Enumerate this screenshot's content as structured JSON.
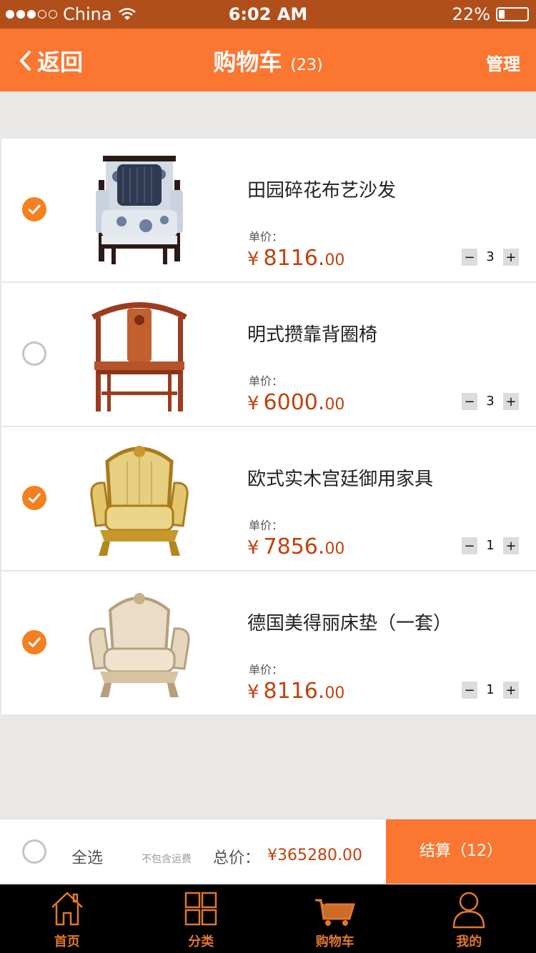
{
  "status_bar": {
    "carrier": "China",
    "time": "6:02 AM",
    "battery": "22%",
    "battery_level": 0.22
  },
  "nav": {
    "back": "返回",
    "title": "购物车",
    "count": "(23)",
    "manage": "管理"
  },
  "items": [
    {
      "name": "田园碎花布艺沙发",
      "unit_label": "单价：",
      "currency": "¥",
      "price_int": "8116.",
      "price_dec": "00",
      "qty": "3",
      "checked": true,
      "image": "floral-upholstered-armchair"
    },
    {
      "name": "明式攒靠背圈椅",
      "unit_label": "单价：",
      "currency": "¥",
      "price_int": "6000.",
      "price_dec": "00",
      "qty": "3",
      "checked": false,
      "image": "ming-style-wooden-chair"
    },
    {
      "name": "欧式实木宫廷御用家具",
      "unit_label": "单价：",
      "currency": "¥",
      "price_int": "7856.",
      "price_dec": "00",
      "qty": "1",
      "checked": true,
      "image": "gold-baroque-armchair"
    },
    {
      "name": "德国美得丽床垫（一套）",
      "unit_label": "单价：",
      "currency": "¥",
      "price_int": "8116.",
      "price_dec": "00",
      "qty": "1",
      "checked": true,
      "image": "cream-baroque-armchair"
    }
  ],
  "checkout": {
    "select_all": "全选",
    "no_shipping": "不包含运费",
    "total_label": "总价：",
    "total_value": "¥365280.00",
    "pay_button": "结算（12）"
  },
  "tabs": [
    {
      "label": "首页",
      "icon": "home-icon"
    },
    {
      "label": "分类",
      "icon": "grid-icon"
    },
    {
      "label": "购物车",
      "icon": "cart-icon"
    },
    {
      "label": "我的",
      "icon": "user-icon"
    }
  ],
  "colors": {
    "accent": "#fa7631",
    "status_bar": "#b14f1b",
    "price": "#c2410c",
    "check": "#f4801f",
    "tab_label": "#e1782b"
  }
}
